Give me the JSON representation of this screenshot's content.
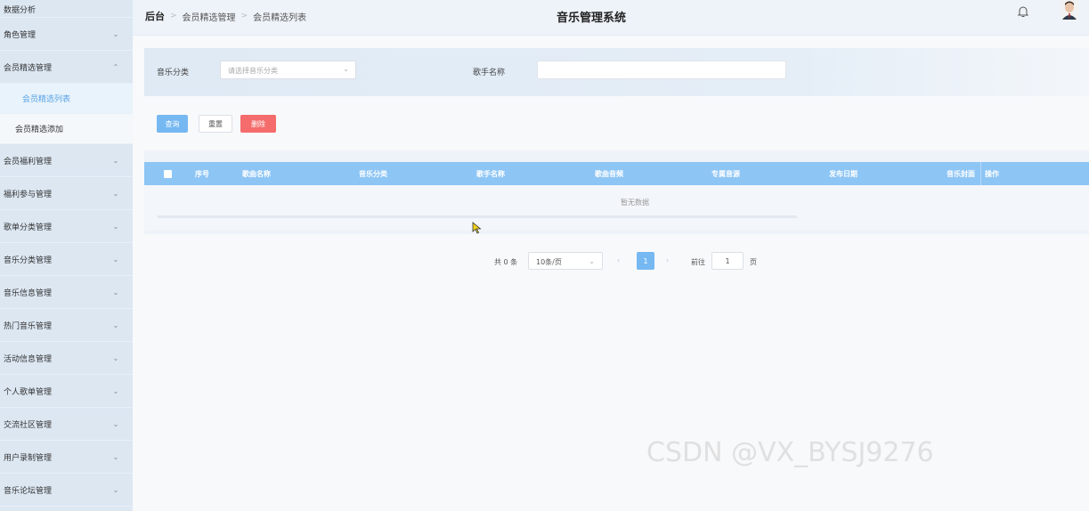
{
  "sidebar": {
    "top_label": "数据分析",
    "items": [
      {
        "label": "角色管理",
        "chev": "⌄"
      },
      {
        "label": "会员精选管理",
        "chev": "⌃"
      }
    ],
    "sub_items": [
      {
        "label": "会员精选列表"
      },
      {
        "label": "会员精选添加"
      }
    ],
    "more_items": [
      {
        "label": "会员福利管理",
        "chev": "⌄"
      },
      {
        "label": "福利参与管理",
        "chev": "⌄"
      },
      {
        "label": "歌单分类管理",
        "chev": "⌄"
      },
      {
        "label": "音乐分类管理",
        "chev": "⌄"
      },
      {
        "label": "音乐信息管理",
        "chev": "⌄"
      },
      {
        "label": "热门音乐管理",
        "chev": "⌄"
      },
      {
        "label": "活动信息管理",
        "chev": "⌄"
      },
      {
        "label": "个人歌单管理",
        "chev": "⌄"
      },
      {
        "label": "交流社区管理",
        "chev": "⌄"
      },
      {
        "label": "用户录制管理",
        "chev": "⌄"
      },
      {
        "label": "音乐论坛管理",
        "chev": "⌄"
      }
    ]
  },
  "header": {
    "breadcrumb": {
      "home": "后台",
      "sep": ">",
      "level1": "会员精选管理",
      "level2": "会员精选列表"
    },
    "title": "音乐管理系统",
    "bell_icon": "bell-icon",
    "avatar_icon": "avatar"
  },
  "filters": {
    "category_label": "音乐分类",
    "category_placeholder": "请选择音乐分类",
    "singer_label": "歌手名称",
    "singer_value": ""
  },
  "buttons": {
    "query": "查询",
    "reset": "重置",
    "delete": "删除"
  },
  "table": {
    "columns": [
      "序号",
      "歌曲名称",
      "音乐分类",
      "歌手名称",
      "歌曲音频",
      "专属音源",
      "发布日期",
      "音乐封面",
      "操作"
    ],
    "rows": [],
    "empty_text": "暂无数据"
  },
  "pagination": {
    "total": "共 0 条",
    "page_size": "10条/页",
    "prev": "‹",
    "current_page": "1",
    "next": "›",
    "goto_label": "前往",
    "goto_value": "1",
    "page_suffix": "页"
  },
  "watermark": "CSDN @VX_BYSJ9276",
  "colors": {
    "primary": "#76b8f2",
    "header_row": "#8dc5f5",
    "danger": "#f56c6c",
    "sidebar_bg": "#dce7f2",
    "active_sub": "#5aa3e6"
  }
}
